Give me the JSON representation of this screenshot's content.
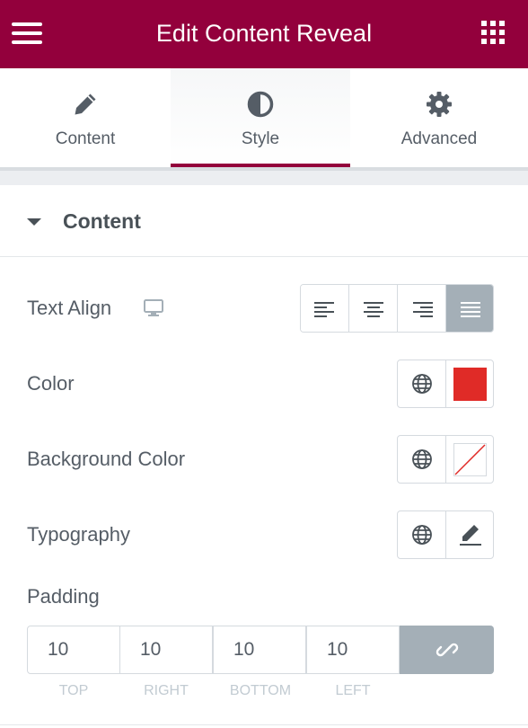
{
  "header": {
    "title": "Edit Content Reveal",
    "menu_icon": "hamburger-menu-icon",
    "apps_icon": "grid-apps-icon",
    "background": "#93003c"
  },
  "tabs": [
    {
      "label": "Content",
      "icon": "pencil-icon",
      "active": false
    },
    {
      "label": "Style",
      "icon": "half-circle-icon",
      "active": true
    },
    {
      "label": "Advanced",
      "icon": "gear-icon",
      "active": false
    }
  ],
  "section": {
    "title": "Content",
    "expanded": true
  },
  "controls": {
    "text_align": {
      "label": "Text Align",
      "responsive_icon": "monitor-icon",
      "options": [
        "left",
        "center",
        "right",
        "justify"
      ],
      "selected": "justify"
    },
    "color": {
      "label": "Color",
      "value": "#e02b27"
    },
    "background_color": {
      "label": "Background Color",
      "value": "none"
    },
    "typography": {
      "label": "Typography"
    },
    "padding": {
      "label": "Padding",
      "top": "10",
      "right": "10",
      "bottom": "10",
      "left": "10",
      "labels": {
        "top": "TOP",
        "right": "RIGHT",
        "bottom": "BOTTOM",
        "left": "LEFT"
      },
      "linked": true
    }
  },
  "colors": {
    "accent": "#93003c",
    "button_active": "#a4afb7"
  }
}
